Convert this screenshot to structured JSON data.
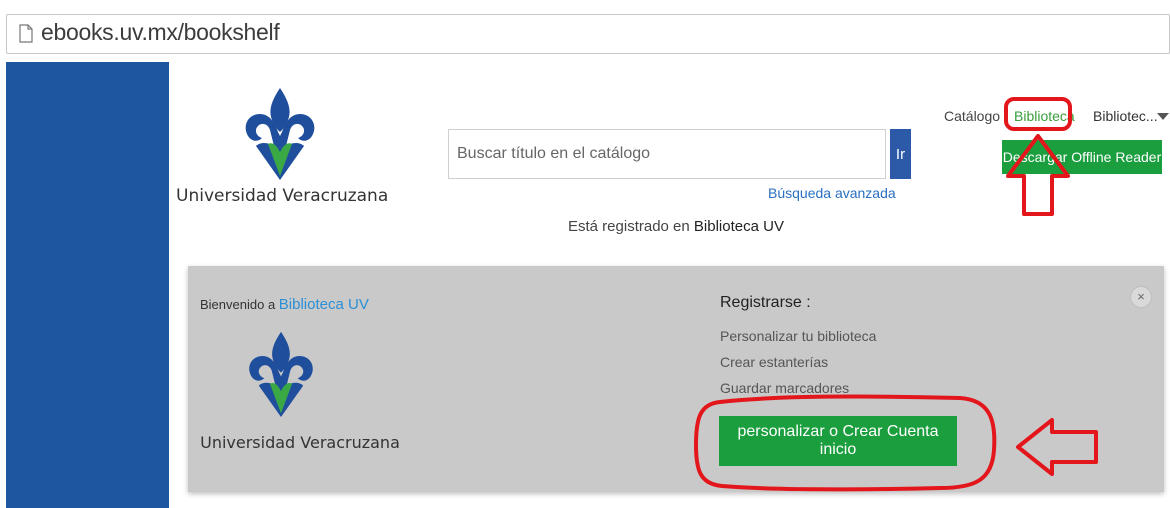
{
  "browser": {
    "url": "ebooks.uv.mx/bookshelf"
  },
  "header": {
    "logo_text": "Universidad Veracruzana",
    "search": {
      "placeholder": "Buscar título en el catálogo",
      "button_label": "Ir"
    },
    "advanced_search_label": "Búsqueda avanzada",
    "registered_prefix": "Está registrado en",
    "registered_library": "Biblioteca UV"
  },
  "topnav": {
    "catalog": "Catálogo",
    "library": "Biblioteca",
    "user_menu": "Bibliotec...",
    "user_menu_icon": "caret-down-icon"
  },
  "offline_button_label": "Descargar Offline Reader",
  "panel": {
    "welcome_prefix": "Bienvenido a",
    "welcome_library": "Biblioteca UV",
    "logo_text": "Universidad Veracruzana",
    "register_title": "Registrarse :",
    "benefits": [
      "Personalizar tu biblioteca",
      "Crear estanterías",
      "Guardar marcadores"
    ],
    "close_label": "×",
    "create_button_label": "personalizar o Crear Cuenta inicio"
  },
  "colors": {
    "sidebar": "#1e56a0",
    "accent_green": "#1b9e3e",
    "annotation_red": "#e3161c",
    "logo_blue": "#1f4e9c",
    "logo_green": "#39a845"
  }
}
